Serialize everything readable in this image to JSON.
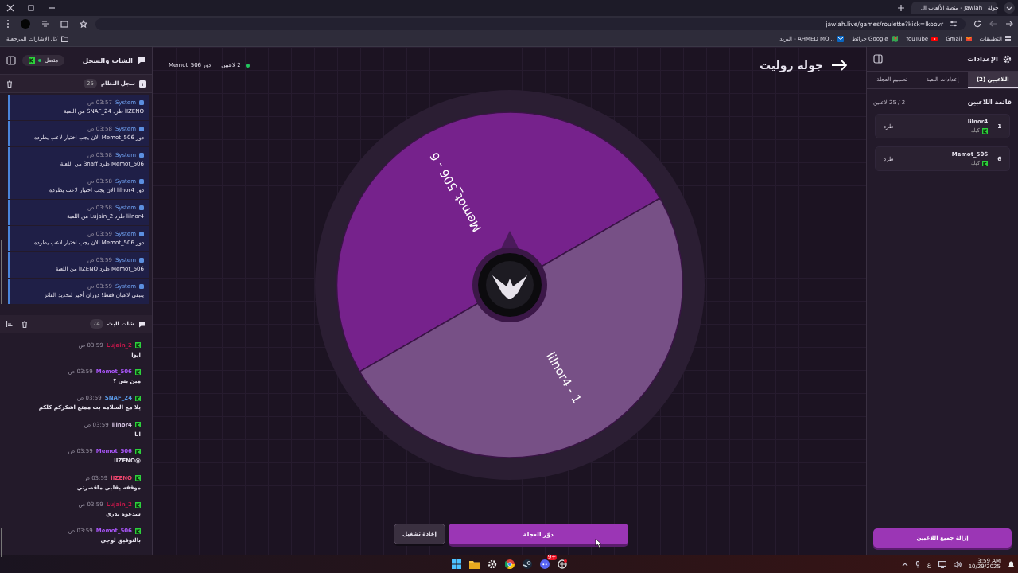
{
  "browser": {
    "tab_title": "جولة | Jawlah - منصة الألعاب ال",
    "url": "jawlah.live/games/roulette?kick=lkoovr",
    "bookmarks": [
      {
        "label": "التطبيقات",
        "kind": "apps"
      },
      {
        "label": "Gmail",
        "kind": "gmail"
      },
      {
        "label": "YouTube",
        "kind": "youtube"
      },
      {
        "label": "خرائط Google",
        "kind": "maps"
      },
      {
        "label": "البريد - AHMED MO...",
        "kind": "mail"
      }
    ],
    "all_bookmarks": "كل الإشارات المرجعية"
  },
  "chat_panel": {
    "title": "الشات والسجل",
    "connection": {
      "label": "متصل",
      "connected": true
    },
    "system_log": {
      "title": "سجل النظام",
      "count": "25",
      "entries": [
        {
          "sender": "System",
          "time": "03:57 ص",
          "text": "lIZENO طرد SNAF_24 من اللعبة"
        },
        {
          "sender": "System",
          "time": "03:58 ص",
          "text": "دور Memot_506 الان يجب اختيار لاعب يطرده"
        },
        {
          "sender": "System",
          "time": "03:58 ص",
          "text": "Memot_506 طرد 3naff من اللعبة"
        },
        {
          "sender": "System",
          "time": "03:58 ص",
          "text": "دور lilnor4 الان يجب اختيار لاعب يطرده"
        },
        {
          "sender": "System",
          "time": "03:58 ص",
          "text": "lilnor4 طرد Lujain_2 من اللعبة"
        },
        {
          "sender": "System",
          "time": "03:59 ص",
          "text": "دور Memot_506 الان يجب اختيار لاعب يطرده"
        },
        {
          "sender": "System",
          "time": "03:59 ص",
          "text": "Memot_506 طرد lIZENO من اللعبة"
        },
        {
          "sender": "System",
          "time": "03:59 ص",
          "text": "يتبقى لاعبان فقط! دوران أخير لتحديد الفائز"
        }
      ]
    },
    "live_chat": {
      "title": "شات البث",
      "count": "74",
      "messages": [
        {
          "user": "Lujain_2",
          "color": "#c2184a",
          "time": "03:59 ص",
          "text": "ايوا"
        },
        {
          "user": "Memot_506",
          "color": "#a855f7",
          "time": "03:59 ص",
          "text": "مين بس ؟"
        },
        {
          "user": "SNAF_24",
          "color": "#5b9be8",
          "time": "03:59 ص",
          "text": "يلا مع السلامه بث ممتع اشكركم كلكم"
        },
        {
          "user": "lilnor4",
          "color": "#d9c8e6",
          "time": "03:59 ص",
          "text": "انا"
        },
        {
          "user": "Memot_506",
          "color": "#a855f7",
          "time": "03:59 ص",
          "text": "@lIZENO"
        },
        {
          "user": "lIZENO",
          "color": "#f0466e",
          "time": "03:59 ص",
          "text": "موقفه يقلبي ماقصرتي"
        },
        {
          "user": "Lujain_2",
          "color": "#c2184a",
          "time": "03:59 ص",
          "text": "شدعوه تدري"
        },
        {
          "user": "Memot_506",
          "color": "#a855f7",
          "time": "03:59 ص",
          "text": "بالتوفيق لوجي"
        }
      ]
    }
  },
  "game": {
    "title": "جولة روليت",
    "players_count": "2 لاعبين",
    "turn": "دور Memot_506",
    "wheel": {
      "segments": [
        {
          "label": "Memot_506 - 6",
          "color": "#76228c"
        },
        {
          "label": "lilnor4 - 1",
          "color": "#775086"
        }
      ]
    },
    "spin_button": "دوّر العجلة",
    "restart_button": "إعادة تشغيل"
  },
  "settings_panel": {
    "title": "الإعدادات",
    "tabs": [
      {
        "label": "اللاعبين (2)",
        "selected": true
      },
      {
        "label": "إعدادات اللعبة",
        "selected": false
      },
      {
        "label": "تصميم العجلة",
        "selected": false
      }
    ],
    "list_title": "قائمة اللاعبين",
    "capacity": "2 / 25 لاعبين",
    "players": [
      {
        "number": "1",
        "name": "lilnor4",
        "platform": "كيك",
        "action": "طرد"
      },
      {
        "number": "6",
        "name": "Memot_506",
        "platform": "كيك",
        "action": "طرد"
      }
    ],
    "clear_button": "إزالة جميع اللاعبين"
  },
  "taskbar": {
    "language": "ع",
    "time": "3:59 AM",
    "date": "10/29/2025",
    "discord_badge": "9+"
  }
}
